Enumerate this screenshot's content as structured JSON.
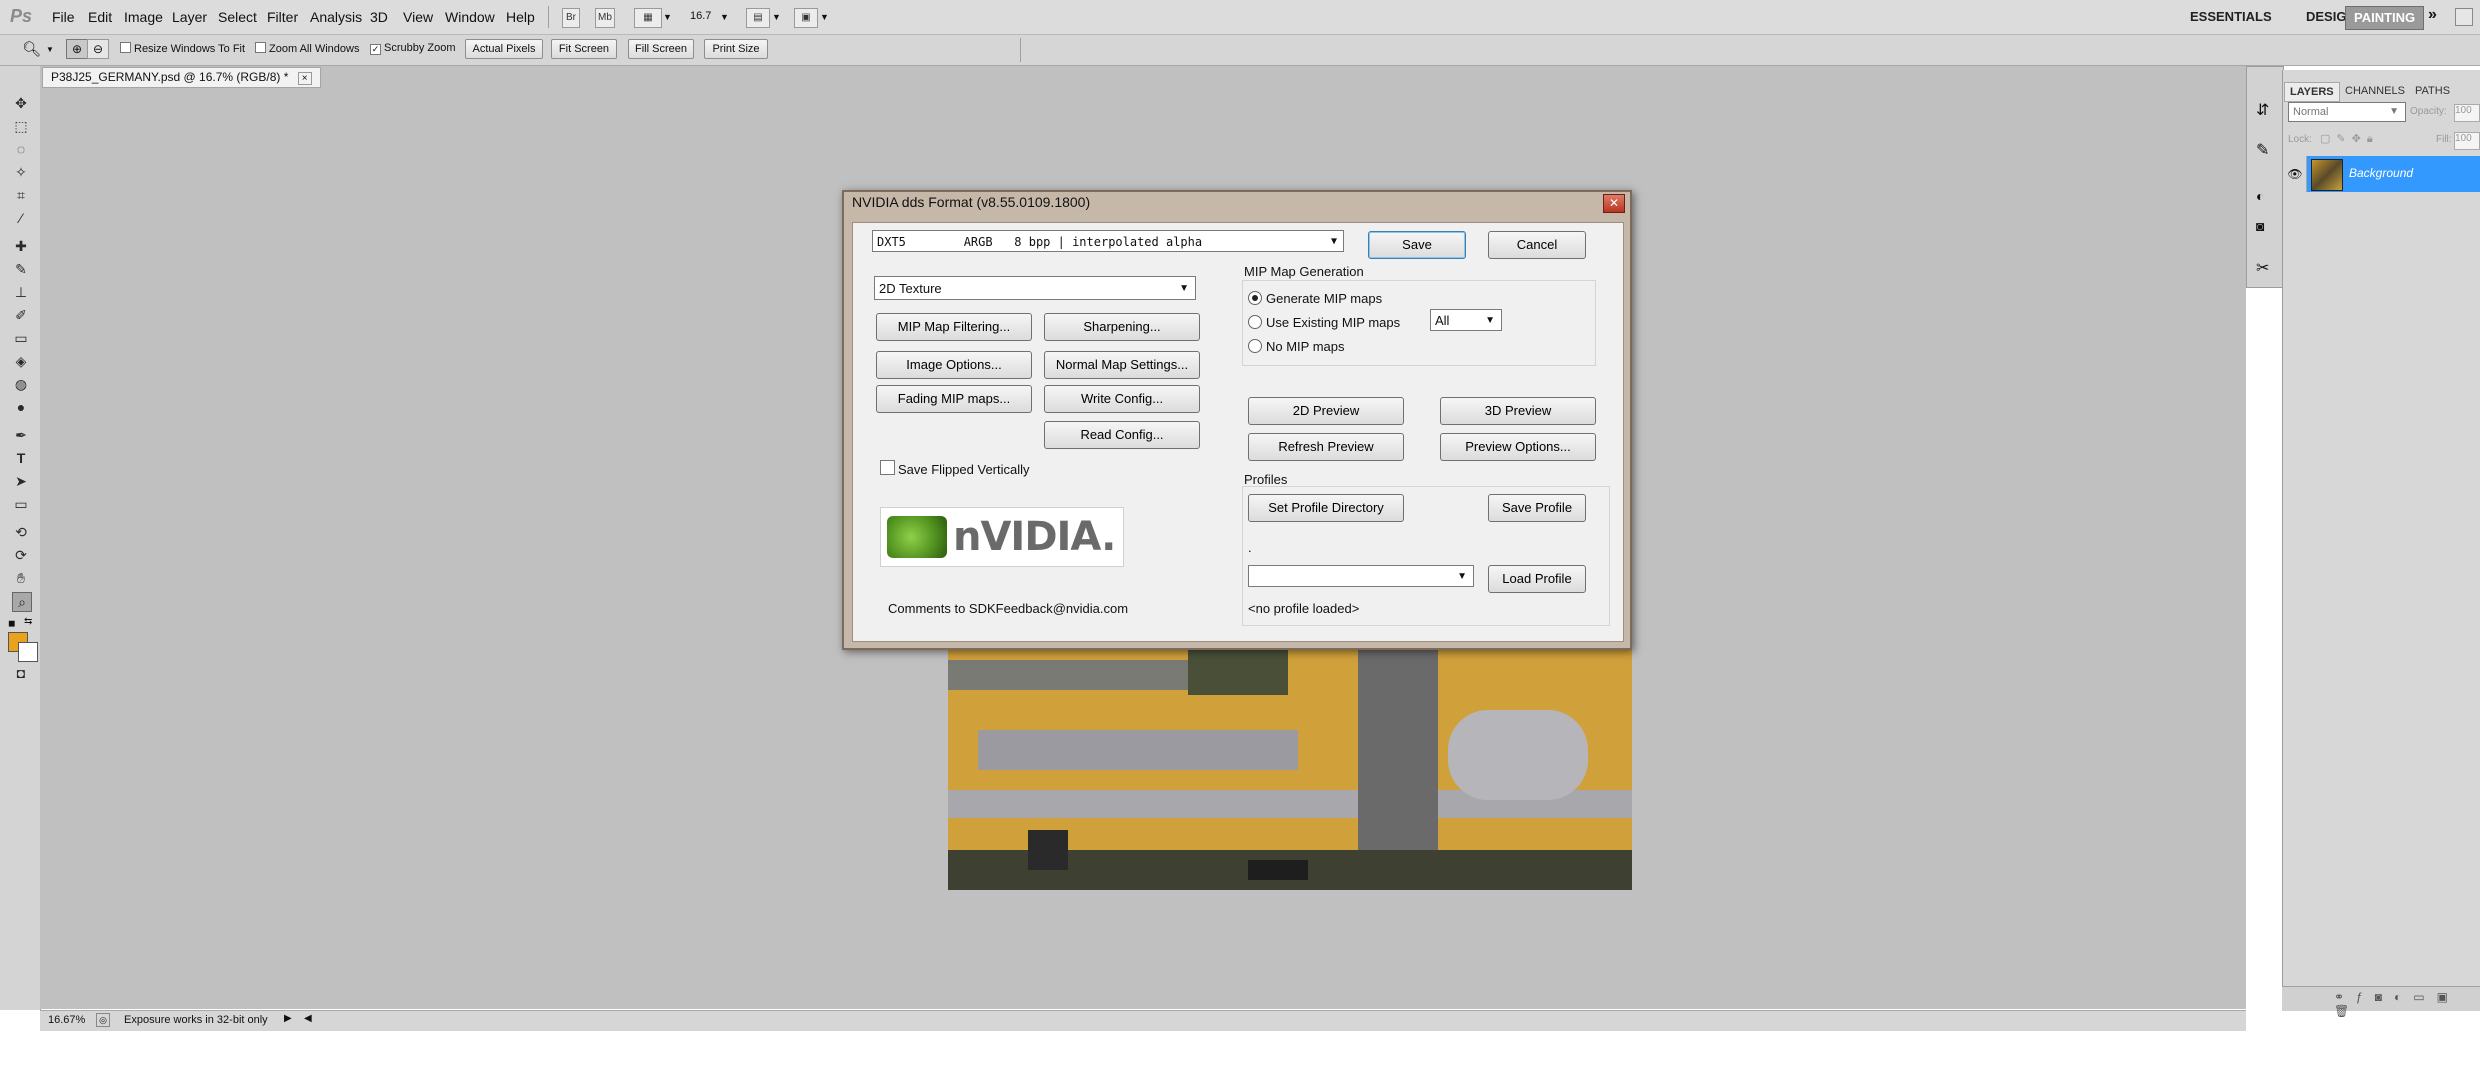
{
  "app": {
    "logo": "Ps",
    "menu": [
      "File",
      "Edit",
      "Image",
      "Layer",
      "Select",
      "Filter",
      "Analysis",
      "3D",
      "View",
      "Window",
      "Help"
    ],
    "menubar_buttons": [
      "Br",
      "Mb"
    ],
    "zoom_value": "16.7",
    "workspaces": [
      "ESSENTIALS",
      "DESIGN",
      "PAINTING"
    ],
    "workspace_more": "»"
  },
  "options_bar": {
    "resize_windows": "Resize Windows To Fit",
    "zoom_all": "Zoom All Windows",
    "scrubby_zoom": "Scrubby Zoom",
    "actual_pixels": "Actual Pixels",
    "fit_screen": "Fit Screen",
    "fill_screen": "Fill Screen",
    "print_size": "Print Size"
  },
  "document": {
    "tab_title": "P38J25_GERMANY.psd @ 16.7% (RGB/8) *",
    "close": "×"
  },
  "status": {
    "zoom": "16.67%",
    "message": "Exposure works in 32-bit only"
  },
  "layers_panel": {
    "tabs": [
      "LAYERS",
      "CHANNELS",
      "PATHS"
    ],
    "blend_mode": "Normal",
    "opacity_label": "Opacity:",
    "opacity_value": "100",
    "lock_label": "Lock:",
    "fill_label": "Fill:",
    "fill_value": "100",
    "layer_name": "Background"
  },
  "dialog": {
    "title": "NVIDIA dds Format (v8.55.0109.1800)",
    "close": "✕",
    "format_value": "DXT5        ARGB   8 bpp | interpolated alpha",
    "save": "Save",
    "cancel": "Cancel",
    "texture_type": "2D Texture",
    "mip_map_filtering": "MIP Map Filtering...",
    "sharpening": "Sharpening...",
    "image_options": "Image Options...",
    "normal_map_settings": "Normal Map Settings...",
    "fading_mip_maps": "Fading MIP maps...",
    "write_config": "Write Config...",
    "read_config": "Read Config...",
    "save_flipped": "Save Flipped Vertically",
    "nvidia_logo_text": "nVIDIA.",
    "comments": "Comments to SDKFeedback@nvidia.com",
    "mip_group_label": "MIP Map Generation",
    "generate_mip": "Generate MIP maps",
    "use_existing_mip": "Use Existing MIP maps",
    "no_mip": "No MIP maps",
    "mip_levels": "All",
    "preview_2d": "2D Preview",
    "preview_3d": "3D Preview",
    "refresh_preview": "Refresh Preview",
    "preview_options": "Preview Options...",
    "profiles_label": "Profiles",
    "set_profile_dir": "Set Profile Directory",
    "save_profile": "Save Profile",
    "profile_path": ".",
    "load_profile": "Load Profile",
    "no_profile": "<no profile loaded>"
  }
}
